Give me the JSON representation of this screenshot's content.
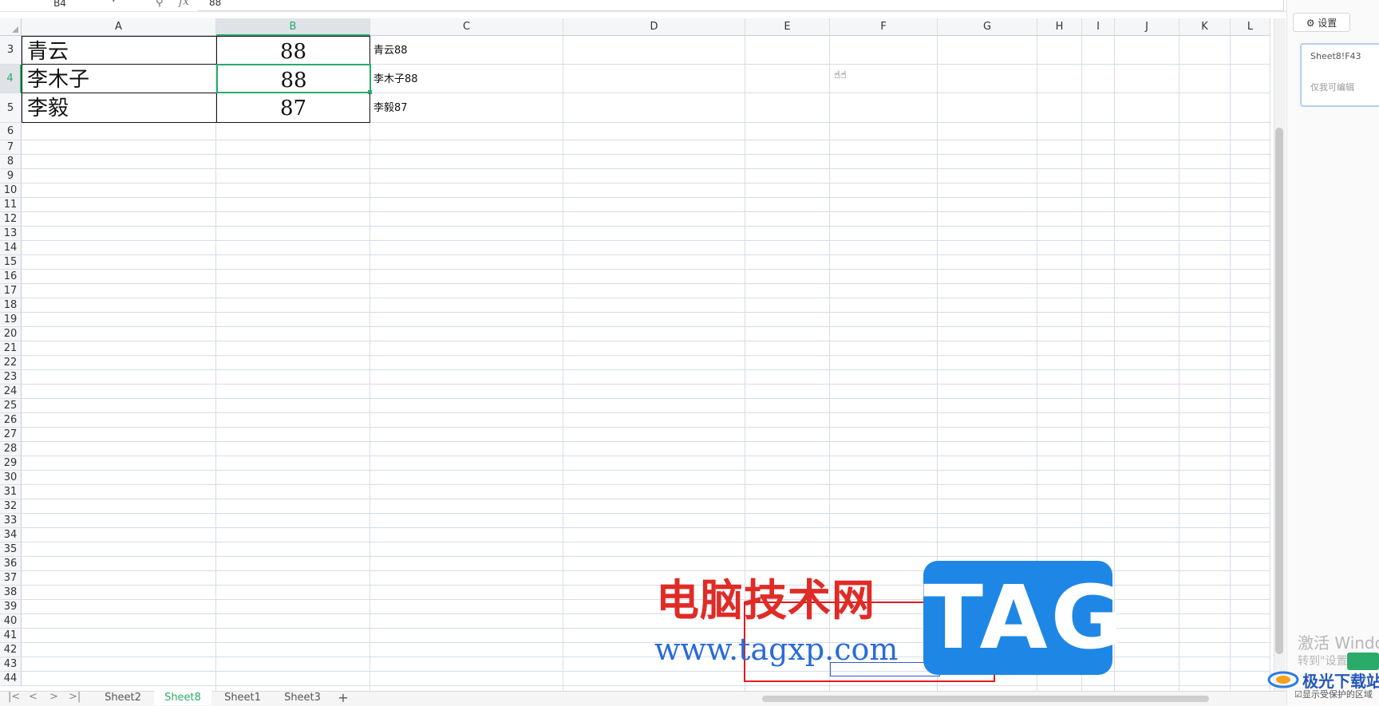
{
  "formula_bar": {
    "name_box": "B4",
    "dropdown_glyph": "▾",
    "zoom_icon": "⚲",
    "fx_label": "fx",
    "value": "88"
  },
  "columns": [
    "A",
    "B",
    "C",
    "D",
    "E",
    "F",
    "G",
    "H",
    "I",
    "J",
    "K",
    "L"
  ],
  "selected_column": "B",
  "rows": [
    "3",
    "4",
    "5",
    "6",
    "7",
    "8",
    "9",
    "10",
    "11",
    "12",
    "13",
    "14",
    "15",
    "16",
    "17",
    "18",
    "19",
    "20",
    "21",
    "22",
    "23",
    "24",
    "25",
    "26",
    "27",
    "28",
    "29",
    "30",
    "31",
    "32",
    "33",
    "34",
    "35",
    "36",
    "37",
    "38",
    "39",
    "40",
    "41",
    "42",
    "43",
    "44"
  ],
  "selected_row": "4",
  "cells": {
    "A3": "青云",
    "B3": "88",
    "C3": "青云88",
    "A4": "李木子",
    "B4": "88",
    "C4": "李木子88",
    "A5": "李毅",
    "B5": "87",
    "C5": "李毅87"
  },
  "cursor_glyph": "☝☝",
  "sheet_tabs": {
    "nav": [
      "|<",
      "<",
      ">",
      ">|"
    ],
    "tabs": [
      "Sheet2",
      "Sheet8",
      "Sheet1",
      "Sheet3"
    ],
    "active": "Sheet8",
    "add": "+"
  },
  "side_panel": {
    "settings_icon": "⚙",
    "settings_label": "设置",
    "range_ref": "Sheet8!F43",
    "range_permission": "仅我可编辑",
    "activate_title": "激活 Windo",
    "activate_sub": "转到\"设置",
    "show_protected": "显示受保护的区域",
    "checkbox": "☑",
    "logo_text": "极光下载站"
  },
  "watermark": {
    "cn": "电脑技术网",
    "url": "www.tagxp.com",
    "tag": "TAG"
  },
  "colors": {
    "accent_green": "#2bab6a",
    "grid_line": "#d6dce8",
    "watermark_red": "#e02b26",
    "watermark_blue": "#1e87e6"
  }
}
